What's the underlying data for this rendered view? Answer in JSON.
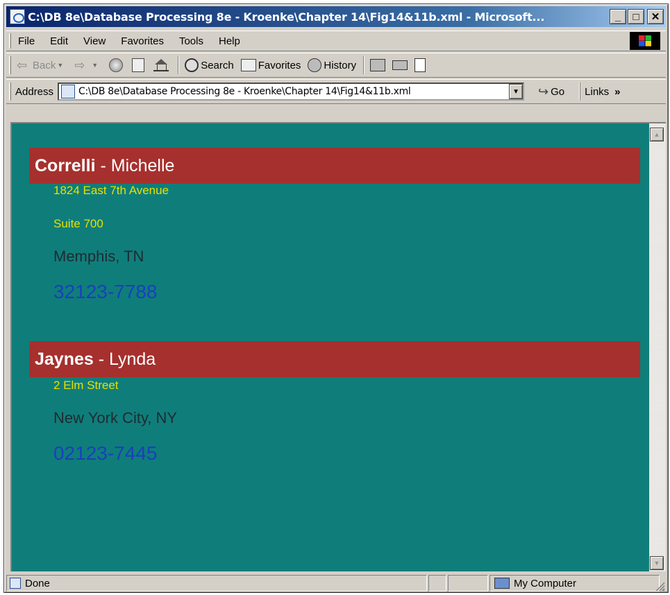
{
  "window": {
    "title": "C:\\DB 8e\\Database Processing 8e - Kroenke\\Chapter 14\\Fig14&11b.xml - Microsoft...",
    "minimize_glyph": "_",
    "maximize_glyph": "□",
    "close_glyph": "✕"
  },
  "menu": [
    "File",
    "Edit",
    "View",
    "Favorites",
    "Tools",
    "Help"
  ],
  "toolbar": {
    "back_label": "Back",
    "search_label": "Search",
    "favorites_label": "Favorites",
    "history_label": "History"
  },
  "address": {
    "label": "Address",
    "value": "C:\\DB 8e\\Database Processing 8e - Kroenke\\Chapter 14\\Fig14&11b.xml",
    "go_label": "Go",
    "links_label": "Links",
    "links_chevron": "»"
  },
  "records": [
    {
      "last_name": "Correlli",
      "separator": " - ",
      "first_name": "Michelle",
      "address_lines": [
        "1824 East 7th Avenue",
        "Suite 700"
      ],
      "city_state": "Memphis, TN",
      "zip": "32123-7788"
    },
    {
      "last_name": "Jaynes",
      "separator": " - ",
      "first_name": "Lynda",
      "address_lines": [
        "2 Elm Street"
      ],
      "city_state": "New York City, NY",
      "zip": "02123-7445"
    }
  ],
  "status": {
    "text": "Done",
    "zone": "My Computer"
  },
  "colors": {
    "page_background": "#0f7e7a",
    "name_bar": "#a6302d",
    "address_text": "#e8e000",
    "city_text": "#1f2a33",
    "zip_text": "#1a3fbf"
  }
}
